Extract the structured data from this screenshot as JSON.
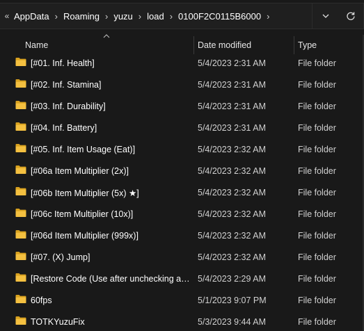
{
  "breadcrumb": {
    "items": [
      "AppData",
      "Roaming",
      "yuzu",
      "load",
      "0100F2C0115B6000"
    ]
  },
  "columns": {
    "name": "Name",
    "date_modified": "Date modified",
    "type": "Type"
  },
  "rows": [
    {
      "name": "[#01. Inf. Health]",
      "date": "5/4/2023 2:31 AM",
      "type": "File folder"
    },
    {
      "name": "[#02. Inf. Stamina]",
      "date": "5/4/2023 2:31 AM",
      "type": "File folder"
    },
    {
      "name": "[#03. Inf. Durability]",
      "date": "5/4/2023 2:31 AM",
      "type": "File folder"
    },
    {
      "name": "[#04. Inf. Battery]",
      "date": "5/4/2023 2:31 AM",
      "type": "File folder"
    },
    {
      "name": "[#05. Inf. Item Usage (Eat)]",
      "date": "5/4/2023 2:32 AM",
      "type": "File folder"
    },
    {
      "name": "[#06a Item Multiplier (2x)]",
      "date": "5/4/2023 2:32 AM",
      "type": "File folder"
    },
    {
      "name": "[#06b Item Multiplier (5x) ★]",
      "date": "5/4/2023 2:32 AM",
      "type": "File folder"
    },
    {
      "name": "[#06c Item Multiplier (10x)]",
      "date": "5/4/2023 2:32 AM",
      "type": "File folder"
    },
    {
      "name": "[#06d Item Multiplier (999x)]",
      "date": "5/4/2023 2:32 AM",
      "type": "File folder"
    },
    {
      "name": "[#07. (X) Jump]",
      "date": "5/4/2023 2:32 AM",
      "type": "File folder"
    },
    {
      "name": "[Restore Code (Use after unchecking any ...",
      "date": "5/4/2023 2:29 AM",
      "type": "File folder"
    },
    {
      "name": "60fps",
      "date": "5/1/2023 9:07 PM",
      "type": "File folder"
    },
    {
      "name": "TOTKYuzuFix",
      "date": "5/3/2023 9:44 AM",
      "type": "File folder"
    }
  ],
  "colors": {
    "background": "#191919",
    "folder_yellow": "#f4c040",
    "folder_dark": "#d9a21f",
    "divider": "#3a3a3a"
  },
  "icons": {
    "overflow": "double-chevron-left-icon",
    "separator": "chevron-right-icon",
    "dropdown": "chevron-down-icon",
    "refresh": "refresh-icon",
    "folder": "folder-icon",
    "sort": "sort-up-icon"
  }
}
